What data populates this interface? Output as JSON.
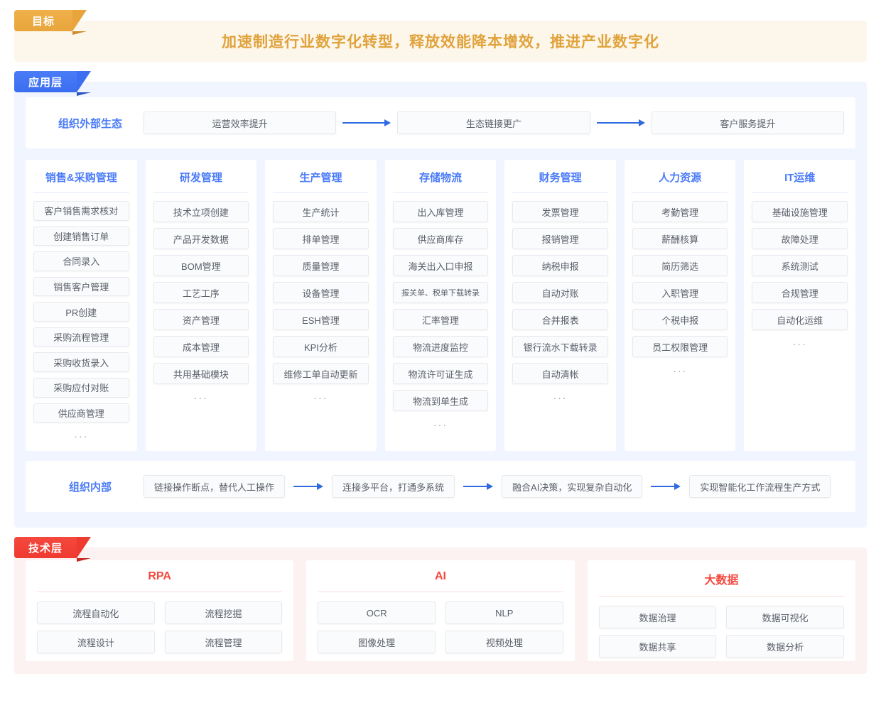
{
  "goal": {
    "ribbon_label": "目标",
    "title": "加速制造行业数字化转型，释放效能降本增效，推进产业数字化",
    "accent_color": "#e0a33c",
    "ribbon_color": "#e8a53c",
    "banner_bg": "#fdf6ea"
  },
  "application_layer": {
    "ribbon_label": "应用层",
    "ribbon_color": "#3b6ef0",
    "body_bg": "#f1f5ff",
    "accent_color": "#4a7bf7",
    "external_band": {
      "label": "组织外部生态",
      "steps": [
        "运营效率提升",
        "生态链接更广",
        "客户服务提升"
      ],
      "connector": "arrow-right-icon"
    },
    "columns": [
      {
        "title": "销售&采购管理",
        "items": [
          "客户销售需求核对",
          "创建销售订单",
          "合同录入",
          "销售客户管理",
          "PR创建",
          "采购流程管理",
          "采购收货录入",
          "采购应付对账",
          "供应商管理"
        ],
        "more": "···"
      },
      {
        "title": "研发管理",
        "items": [
          "技术立项创建",
          "产品开发数据",
          "BOM管理",
          "工艺工序",
          "资产管理",
          "成本管理",
          "共用基础模块"
        ],
        "more": "···"
      },
      {
        "title": "生产管理",
        "items": [
          "生产统计",
          "排单管理",
          "质量管理",
          "设备管理",
          "ESH管理",
          "KPI分析",
          "维修工单自动更新"
        ],
        "more": "···"
      },
      {
        "title": "存储物流",
        "items": [
          "出入库管理",
          "供应商库存",
          "海关出入口申报",
          "报关单、税单下载转录",
          "汇率管理",
          "物流进度监控",
          "物流许可证生成",
          "物流到单生成"
        ],
        "more": "···"
      },
      {
        "title": "财务管理",
        "items": [
          "发票管理",
          "报销管理",
          "纳税申报",
          "自动对账",
          "合并报表",
          "银行流水下载转录",
          "自动清帐"
        ],
        "more": "···"
      },
      {
        "title": "人力资源",
        "items": [
          "考勤管理",
          "薪酬核算",
          "简历筛选",
          "入职管理",
          "个税申报",
          "员工权限管理"
        ],
        "more": "···"
      },
      {
        "title": "IT运维",
        "items": [
          "基础设施管理",
          "故障处理",
          "系统测试",
          "合规管理",
          "自动化运维"
        ],
        "more": "···"
      }
    ],
    "internal_band": {
      "label": "组织内部",
      "steps": [
        "链接操作断点，替代人工操作",
        "连接多平台，打通多系统",
        "融合AI决策，实现复杂自动化",
        "实现智能化工作流程生产方式"
      ],
      "connector": "arrow-right-icon"
    }
  },
  "technology_layer": {
    "ribbon_label": "技术层",
    "ribbon_color": "#ef3a30",
    "body_bg": "#fdf2f2",
    "accent_color": "#f4483e",
    "cards": [
      {
        "title": "RPA",
        "items": [
          "流程自动化",
          "流程挖掘",
          "流程设计",
          "流程管理"
        ]
      },
      {
        "title": "AI",
        "items": [
          "OCR",
          "NLP",
          "图像处理",
          "视频处理"
        ]
      },
      {
        "title": "大数据",
        "items": [
          "数据治理",
          "数据可视化",
          "数据共享",
          "数据分析"
        ]
      }
    ]
  }
}
